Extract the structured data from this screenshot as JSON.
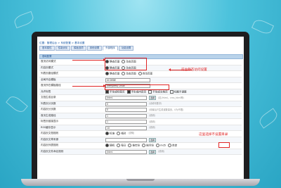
{
  "breadcrumb": "位置：管理后台 > 系统配置 > 基本设置",
  "tabs": [
    "基本属性",
    "性能优化",
    "模板选项",
    "其他设置",
    "外部程序",
    "功能设置"
  ],
  "active_tab": 4,
  "section_title": "基础配置",
  "rows": [
    {
      "label": "首页访问模式",
      "type": "radio",
      "options": [
        "静态页面",
        "动态页面"
      ],
      "selected": 0
    },
    {
      "label": "内容页模式",
      "type": "radio",
      "options": [
        "静态页面",
        "动态页面"
      ],
      "selected": 0
    },
    {
      "label": "列表页路径模式",
      "type": "radio",
      "options": [
        "静态页面",
        "动态页面",
        "自动页面"
      ],
      "selected": 0
    },
    {
      "label": "全局开启模板",
      "type": "select",
      "value": "IX DEDE"
    },
    {
      "label": "首页所在模板路径",
      "type": "select",
      "value": "/templets/ DEDE"
    },
    {
      "label": "允许标签",
      "type": "check",
      "options": [
        "不生成标签页",
        "不生成内容页",
        "不生成文档页",
        "标题不调整"
      ],
      "selected": [
        0,
        1
      ]
    },
    {
      "label": "文档生成目录",
      "type": "input",
      "value": "/html",
      "button": "选择",
      "hint": "(如 /html，cms_html等)"
    },
    {
      "label": "列表页分页数",
      "type": "input",
      "value": "0",
      "hint": "(请填写数字)"
    },
    {
      "label": "内容页分页数",
      "type": "input",
      "value": "0",
      "hint": "(设置后只生成该数量页，0为不限)"
    },
    {
      "label": "首页生成路径",
      "type": "input",
      "value": "1",
      "hint": "(说明)"
    },
    {
      "label": "标签页链接显示",
      "type": "input",
      "value": "1",
      "hint": "(说明)"
    },
    {
      "label": "RSS缓存显示",
      "type": "input",
      "value": "10",
      "hint": "(说明)"
    },
    {
      "label": "内容页文档规则",
      "type": "radio",
      "options": [
        "标准",
        "相对"
      ],
      "selected": 0,
      "hint": "(说明)"
    },
    {
      "label": "内容页文章来源",
      "type": "input",
      "value": "",
      "button": "选择",
      "hint": ""
    },
    {
      "label": "内容页列表规则",
      "type": "radio",
      "options": [
        "随机",
        "每日",
        "按年份",
        "按月份",
        "md5",
        "自定"
      ],
      "selected": 0
    },
    {
      "label": "内容页文件命名规则",
      "type": "input",
      "value": "/html",
      "button": "选择",
      "hint": "(说明)"
    }
  ],
  "annotations": {
    "top": "前台静态访问设置",
    "bottom": "这里选择不设置目录"
  },
  "colors": {
    "accent": "#e02424",
    "header": "#b9d3ea",
    "link": "#1f5da8"
  }
}
